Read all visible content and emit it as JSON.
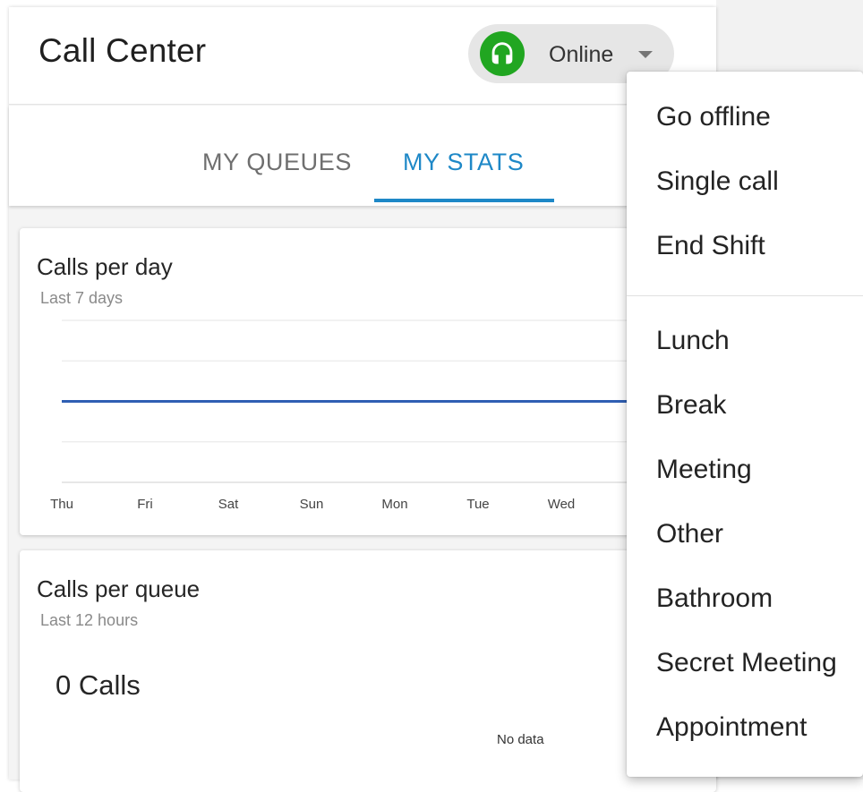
{
  "header": {
    "title": "Call Center",
    "status": {
      "label": "Online",
      "icon": "headset-icon",
      "color": "#21a621"
    }
  },
  "tabs": [
    {
      "label": "MY QUEUES",
      "active": false
    },
    {
      "label": "MY STATS",
      "active": true
    }
  ],
  "accent_color": "#1e88c7",
  "cards": {
    "calls_per_day": {
      "title": "Calls per day",
      "subtitle": "Last 7 days"
    },
    "calls_per_queue": {
      "title": "Calls per queue",
      "subtitle": "Last 12 hours",
      "count": "0 Calls",
      "empty_text": "No data"
    }
  },
  "chart_data": {
    "type": "line",
    "categories": [
      "Thu",
      "Fri",
      "Sat",
      "Sun",
      "Mon",
      "Tue",
      "Wed"
    ],
    "series": [
      {
        "values": [
          0,
          0,
          0,
          0,
          0,
          0,
          0
        ],
        "color": "#2f5fb3"
      }
    ],
    "grid": true
  },
  "status_menu": {
    "group1": [
      {
        "label": "Go offline"
      },
      {
        "label": "Single call"
      },
      {
        "label": "End Shift"
      }
    ],
    "group2": [
      {
        "label": "Lunch"
      },
      {
        "label": "Break"
      },
      {
        "label": "Meeting"
      },
      {
        "label": "Other"
      },
      {
        "label": "Bathroom"
      },
      {
        "label": "Secret Meeting"
      },
      {
        "label": "Appointment"
      }
    ]
  }
}
